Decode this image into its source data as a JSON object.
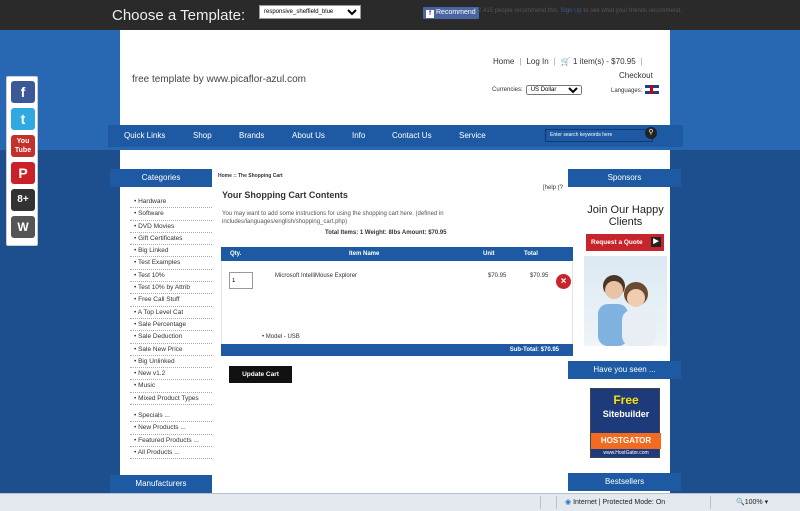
{
  "template_bar": {
    "label": "Choose a Template:",
    "selected": "responsive_sheffield_blue",
    "recommend": "Recommend",
    "fb_note_pre": "2,415 people recommend this.",
    "fb_note_link": "Sign Up",
    "fb_note_post": "to see what your friends recommend."
  },
  "header": {
    "tagline": "free template by www.picaflor-azul.com",
    "home": "Home",
    "login": "Log In",
    "cart": "1 item(s) - $70.95",
    "checkout": "Checkout",
    "currencies_label": "Currencies:",
    "currency": "US Dollar",
    "languages_label": "Languages:"
  },
  "nav": {
    "items": [
      "Quick Links",
      "Shop",
      "Brands",
      "About Us",
      "Info",
      "Contact Us",
      "Service"
    ],
    "search_placeholder": "Enter search keywords here"
  },
  "sidebar": {
    "categories_title": "Categories",
    "categories": [
      "Hardware",
      "Software",
      "DVD Movies",
      "Gift Certificates",
      "Big Linked",
      "Test Examples",
      "Test 10%",
      "Test 10% by Attrib",
      "Free Call Stuff",
      "A Top Level Cat",
      "Sale Percentage",
      "Sale Deduction",
      "Sale New Price",
      "Big Unlinked",
      "New v1.2",
      "Music",
      "Mixed Product Types"
    ],
    "specials": [
      "Specials ...",
      "New Products ...",
      "Featured Products ...",
      "All Products ..."
    ],
    "manufacturers_title": "Manufacturers"
  },
  "cart": {
    "breadcrumb": "Home :: The Shopping Cart",
    "title": "Your Shopping Cart Contents",
    "help": "[help (?",
    "note": "You may want to add some instructions for using the shopping cart here. (defined in includes/languages/english/shopping_cart.php)",
    "totals": "Total Items: 1  Weight: 8lbs  Amount: $70.95",
    "columns": {
      "qty": "Qty.",
      "name": "Item Name",
      "unit": "Unit",
      "total": "Total"
    },
    "item": {
      "qty": "1",
      "name": "Microsoft IntelliMouse Explorer",
      "unit": "$70.95",
      "total": "$70.95",
      "attribute": "Model - USB"
    },
    "subtotal": "Sub-Total: $70.95",
    "update": "Update Cart"
  },
  "right": {
    "sponsors_title": "Sponsors",
    "join": "Join Our Happy Clients",
    "quote": "Request a Quote",
    "seen_title": "Have you seen ...",
    "hg_free": "Free",
    "hg_site": "Sitebuilder",
    "hg_brand": "HOSTGATOR",
    "hg_url": "www.HostGator.com",
    "bestsellers_title": "Bestsellers"
  },
  "status": {
    "zone": "Internet | Protected Mode: On",
    "zoom": "100%"
  },
  "social": [
    "facebook-icon",
    "twitter-icon",
    "youtube-icon",
    "pinterest-icon",
    "googleplus-icon",
    "wordpress-icon"
  ]
}
